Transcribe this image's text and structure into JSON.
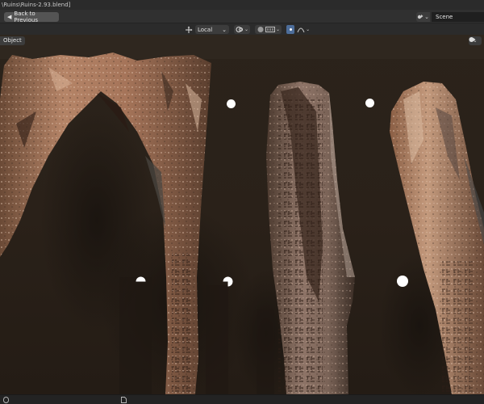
{
  "window": {
    "title": "\\Ruins\\Ruins-2.93.blend]"
  },
  "topbar": {
    "back_label": "Back to Previous",
    "scene_name": "Scene",
    "scene_icon": "scene-icon"
  },
  "view_header": {
    "pivot_icon": "transform-pivot-icon",
    "orientation": "Local",
    "pivot_point_icon": "pivot-point-icon",
    "snap_icon": "snap-icon",
    "proportional_icon": "proportional-editing-icon",
    "falloff_icon": "falloff-icon"
  },
  "viewport": {
    "mode_label": "Object",
    "shading_icon": "viewport-shading-icon",
    "background_color": "#2d251d",
    "light_color": "#ffffff"
  },
  "statusbar": {
    "left_icon": "mouse-icon",
    "center_icon": "document-icon"
  }
}
